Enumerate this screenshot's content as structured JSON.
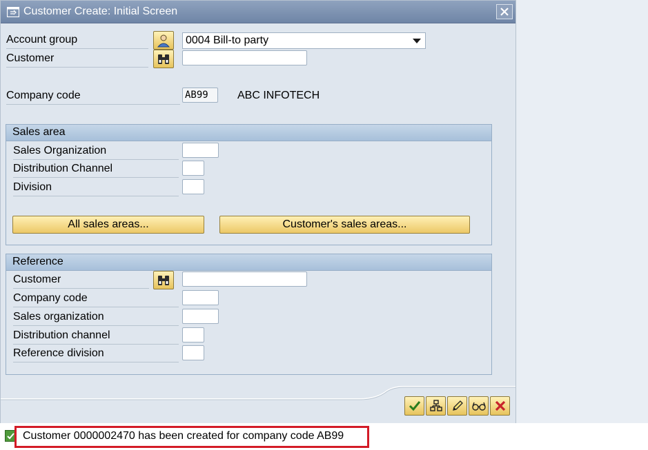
{
  "window": {
    "title": "Customer Create: Initial Screen"
  },
  "header_fields": {
    "account_group": {
      "label": "Account group",
      "value": "0004 Bill-to party"
    },
    "customer": {
      "label": "Customer",
      "value": ""
    },
    "company_code": {
      "label": "Company code",
      "value": "AB99",
      "description": "ABC INFOTECH"
    }
  },
  "sales_area": {
    "title": "Sales area",
    "fields": {
      "sales_org": {
        "label": "Sales Organization",
        "value": ""
      },
      "dist_channel": {
        "label": "Distribution Channel",
        "value": ""
      },
      "division": {
        "label": "Division",
        "value": ""
      }
    },
    "buttons": {
      "all": "All sales areas...",
      "customers": "Customer's sales areas..."
    }
  },
  "reference": {
    "title": "Reference",
    "fields": {
      "customer": {
        "label": "Customer",
        "value": ""
      },
      "company_code": {
        "label": "Company code",
        "value": ""
      },
      "sales_org": {
        "label": "Sales organization",
        "value": ""
      },
      "dist_channel": {
        "label": "Distribution channel",
        "value": ""
      },
      "ref_division": {
        "label": "Reference division",
        "value": ""
      }
    }
  },
  "toolbar": [
    "continue-icon",
    "hierarchy-icon",
    "edit-icon",
    "glasses-icon",
    "cancel-icon"
  ],
  "status": {
    "message": "Customer 0000002470 has been created for company code AB99",
    "type": "success"
  },
  "colors": {
    "title_bar": "#7a8fae",
    "status_highlight": "#d31b27",
    "yellow_button": "#ecc867",
    "group_header": "#b6cbe1"
  }
}
